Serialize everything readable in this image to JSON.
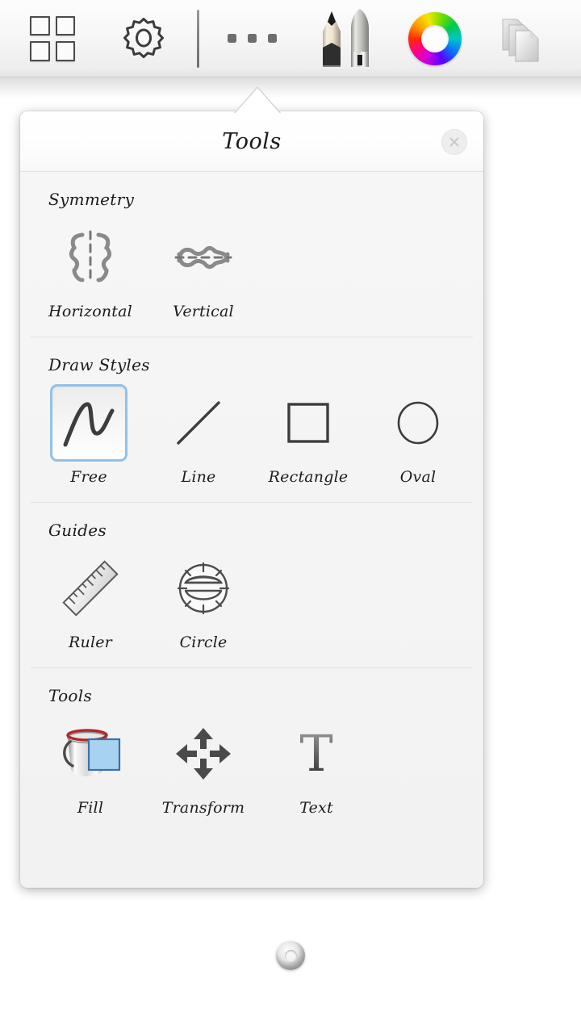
{
  "toolbar": {
    "buttons": [
      {
        "name": "grid",
        "label": "Gallery",
        "icon": "grid-icon"
      },
      {
        "name": "settings",
        "label": "Settings",
        "icon": "gear-icon"
      },
      {
        "name": "more",
        "label": "More",
        "icon": "ellipsis-icon"
      },
      {
        "name": "brushes",
        "label": "Brushes",
        "icon": "pencil-brush-icon"
      },
      {
        "name": "color",
        "label": "Color",
        "icon": "color-wheel-icon"
      },
      {
        "name": "layers",
        "label": "Layers",
        "icon": "layers-icon"
      }
    ],
    "separator": true
  },
  "popup": {
    "title": "Tools",
    "close_icon": "close-icon",
    "sections": [
      {
        "label": "Symmetry",
        "items": [
          {
            "label": "Horizontal",
            "icon": "symmetry-horizontal-icon",
            "selected": false
          },
          {
            "label": "Vertical",
            "icon": "symmetry-vertical-icon",
            "selected": false
          }
        ]
      },
      {
        "label": "Draw Styles",
        "items": [
          {
            "label": "Free",
            "icon": "free-draw-icon",
            "selected": true
          },
          {
            "label": "Line",
            "icon": "line-icon",
            "selected": false
          },
          {
            "label": "Rectangle",
            "icon": "rectangle-icon",
            "selected": false
          },
          {
            "label": "Oval",
            "icon": "oval-icon",
            "selected": false
          }
        ]
      },
      {
        "label": "Guides",
        "items": [
          {
            "label": "Ruler",
            "icon": "ruler-icon",
            "selected": false
          },
          {
            "label": "Circle",
            "icon": "circle-guide-icon",
            "selected": false
          }
        ]
      },
      {
        "label": "Tools",
        "items": [
          {
            "label": "Fill",
            "icon": "paint-bucket-icon",
            "selected": false
          },
          {
            "label": "Transform",
            "icon": "move-arrows-icon",
            "selected": false
          },
          {
            "label": "Text",
            "icon": "text-t-icon",
            "selected": false
          }
        ]
      }
    ]
  },
  "home_button": {
    "name": "home-button",
    "icon": "home-circle-icon"
  },
  "colors": {
    "selection_border": "#93c1e8",
    "panel_bg": "#f4f4f4",
    "header_bg": "#ffffff",
    "toolbar_bg": "#f7f7f7",
    "canvas_bg": "#ffffff",
    "text": "#1c1c1c",
    "icon_gray": "#6e6e6e",
    "fill_swatch": "#a8d3f0",
    "bucket_rim": "#b02a2a"
  }
}
